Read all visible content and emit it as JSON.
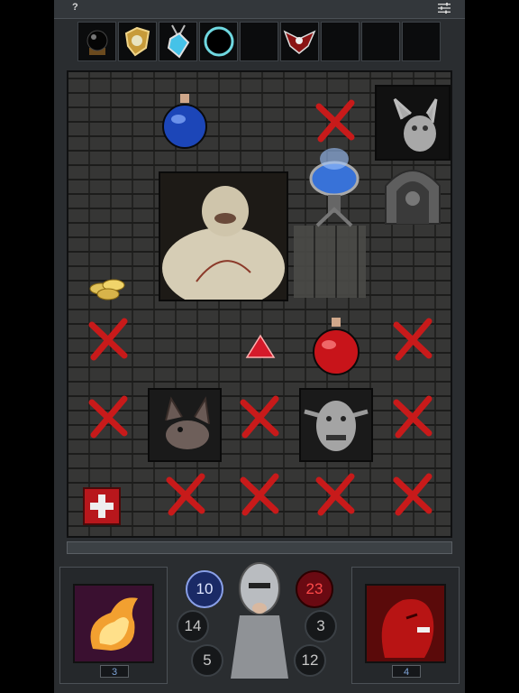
{
  "topbar": {
    "help_label": "?"
  },
  "inventory": [
    {
      "icon": "black-orb-icon"
    },
    {
      "icon": "gold-amulet-icon"
    },
    {
      "icon": "sapphire-amulet-icon"
    },
    {
      "icon": "dark-ring-icon"
    },
    {
      "icon": "empty-slot"
    },
    {
      "icon": "winged-crest-icon"
    },
    {
      "icon": "empty-slot"
    },
    {
      "icon": "empty-slot"
    },
    {
      "icon": "empty-slot"
    }
  ],
  "board": {
    "items": [
      {
        "name": "mana-potion"
      },
      {
        "name": "fat-ogre-monster"
      },
      {
        "name": "scrying-bowl"
      },
      {
        "name": "gargoyle-monster"
      },
      {
        "name": "stone-gate"
      },
      {
        "name": "gold-coins"
      },
      {
        "name": "red-gem"
      },
      {
        "name": "health-potion"
      },
      {
        "name": "bat-monster"
      },
      {
        "name": "goblin-monster"
      },
      {
        "name": "red-cross-card"
      }
    ]
  },
  "hero": {
    "mana": "10",
    "health": "23",
    "attack": "14",
    "defense": "3",
    "gold": "5",
    "armor": "12"
  },
  "left_skill": {
    "count": "3",
    "icon": "fireball-icon"
  },
  "right_skill": {
    "count": "4",
    "icon": "rage-face-icon"
  },
  "colors": {
    "accent_red": "#c81a1a",
    "mana_blue": "#3a64c8",
    "frame": "#2a2d30"
  }
}
